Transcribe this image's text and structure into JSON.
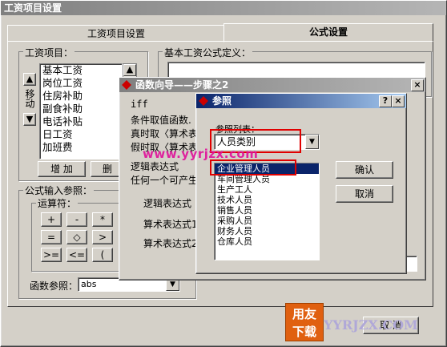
{
  "main": {
    "title": "工资项目设置",
    "tabs": [
      "工资项目设置",
      "公式设置"
    ],
    "salary_items_label": "工资项目：",
    "salary_items": [
      "基本工资",
      "岗位工资",
      "住房补助",
      "副食补助",
      "电话补贴",
      "日工资",
      "加班费"
    ],
    "move_label": "移动",
    "add_button": "增 加",
    "delete_button": "删",
    "formula_def_label": "基本工资公式定义：",
    "formula_input_label": "公式输入参照：",
    "operators_label": "运算符：",
    "operators": [
      "+",
      "-",
      "*",
      "=",
      "◇",
      ">",
      ">=",
      "<=",
      "("
    ],
    "function_ref_label": "函数参照：",
    "function_ref_value": "abs",
    "cancel_button": "取 消"
  },
  "wizard": {
    "title": "函数向导——步骤之2",
    "func_name": "iff",
    "lines": [
      "条件取值函数.",
      "真时取〈算术表达",
      "假时取〈算术表达"
    ],
    "logic_label": "逻辑表达式",
    "any_label": "任何一个可产生",
    "logic_expr_label": "逻辑表达式",
    "arith1_label": "算术表达式1",
    "arith2_label": "算术表达式2"
  },
  "reference": {
    "title": "参照",
    "help": "?",
    "close": "×",
    "list_label": "参照列表：",
    "selected_value": "人员类别",
    "items": [
      "企业管理人员",
      "车间管理人员",
      "生产工人",
      "技术人员",
      "销售人员",
      "采购人员",
      "财务人员",
      "仓库人员"
    ],
    "ok_button": "确认",
    "cancel_button": "取消"
  },
  "watermark": {
    "url_text": "www.yyrjzx.com",
    "brand_top": "用友",
    "brand_bottom": "下载",
    "brand_site": "YYRJZX.COM"
  }
}
